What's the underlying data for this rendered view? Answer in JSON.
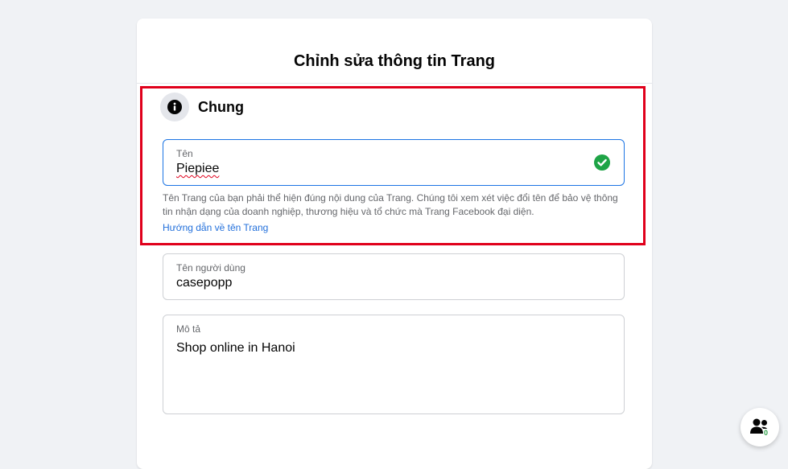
{
  "dialog": {
    "title": "Chỉnh sửa thông tin Trang"
  },
  "section": {
    "heading": "Chung",
    "icon": "info-icon"
  },
  "name_field": {
    "label": "Tên",
    "value": "Piepiee",
    "status_icon": "check-circle-icon",
    "status_color": "#1ea446"
  },
  "help": {
    "text": "Tên Trang của bạn phải thể hiện đúng nội dung của Trang. Chúng tôi xem xét việc đổi tên để bảo vệ thông tin nhận dạng của doanh nghiệp, thương hiệu và tổ chức mà Trang Facebook đại diện.",
    "link": "Hướng dẫn về tên Trang"
  },
  "username_field": {
    "label": "Tên người dùng",
    "value": "casepopp"
  },
  "description_field": {
    "label": "Mô tả",
    "value": "Shop online in Hanoi"
  },
  "chat_fab": {
    "icon": "people-icon",
    "count": "0"
  },
  "colors": {
    "highlight": "#e0001b",
    "focus_border": "#1b74e4",
    "link": "#216fdb"
  }
}
